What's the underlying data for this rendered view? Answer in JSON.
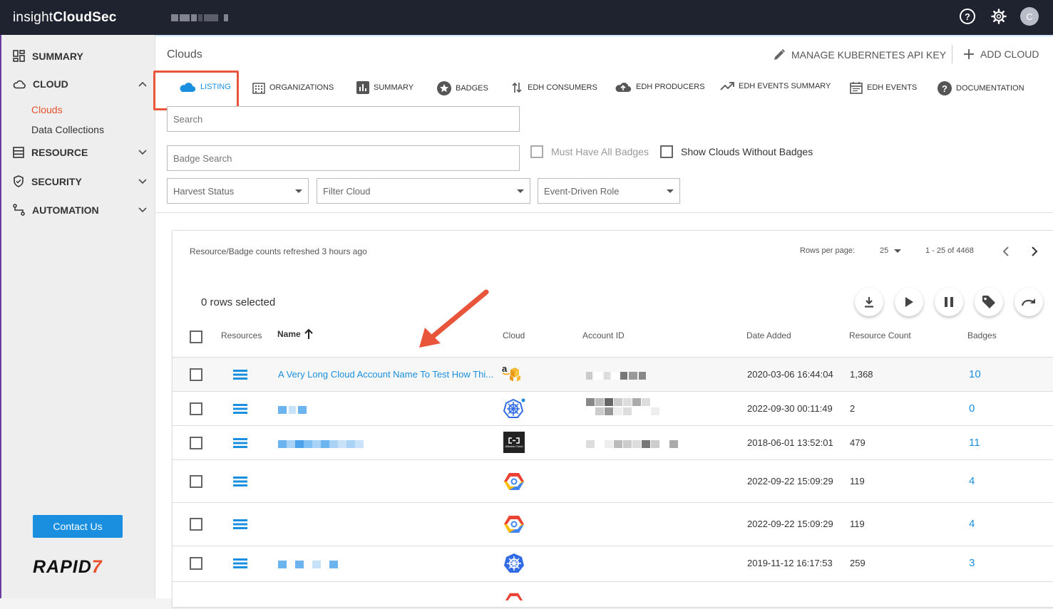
{
  "topbar": {
    "brand_light": "insight",
    "brand_bold": "CloudSec",
    "avatar_initial": "C",
    "help_icon": "help-circle-icon",
    "settings_icon": "gear-icon"
  },
  "sidebar": {
    "items": [
      {
        "label": "SUMMARY",
        "icon": "dashboard-grid-icon"
      },
      {
        "label": "CLOUD",
        "icon": "cloud-icon"
      },
      {
        "label": "RESOURCE",
        "icon": "list-icon"
      },
      {
        "label": "SECURITY",
        "icon": "shield-icon"
      },
      {
        "label": "AUTOMATION",
        "icon": "flow-icon"
      }
    ],
    "cloud_sub": [
      {
        "label": "Clouds",
        "active": true
      },
      {
        "label": "Data Collections",
        "active": false
      }
    ],
    "contact_label": "Contact Us",
    "logo_text": "RAPID",
    "logo_mark": "7"
  },
  "header": {
    "title": "Clouds",
    "manage_label": "MANAGE KUBERNETES API KEY",
    "add_label": "ADD CLOUD"
  },
  "tabs": [
    {
      "label": "LISTING",
      "icon": "cloud-icon",
      "active": true
    },
    {
      "label": "ORGANIZATIONS",
      "icon": "building-icon"
    },
    {
      "label": "SUMMARY",
      "icon": "bar-chart-icon"
    },
    {
      "label": "BADGES",
      "icon": "star-badge-icon"
    },
    {
      "label": "EDH CONSUMERS",
      "icon": "swap-vert-icon"
    },
    {
      "label": "EDH PRODUCERS",
      "icon": "cloud-upload-icon"
    },
    {
      "label": "EDH EVENTS SUMMARY",
      "icon": "trending-up-icon"
    },
    {
      "label": "EDH EVENTS",
      "icon": "calendar-icon"
    },
    {
      "label": "DOCUMENTATION",
      "icon": "help-circle-icon"
    }
  ],
  "filters": {
    "search_placeholder": "Search",
    "badge_search_placeholder": "Badge Search",
    "must_have_all_badges": "Must Have All Badges",
    "show_without_badges": "Show Clouds Without Badges",
    "harvest_status": "Harvest Status",
    "filter_cloud": "Filter Cloud",
    "event_driven_role": "Event-Driven Role"
  },
  "table": {
    "refreshed_text": "Resource/Badge counts refreshed 3 hours ago",
    "rows_per_page_label": "Rows per page:",
    "rows_per_page": "25",
    "range": "1 - 25 of 4468",
    "rows_selected": "0 rows selected",
    "columns": {
      "resources": "Resources",
      "name": "Name",
      "cloud": "Cloud",
      "account_id": "Account ID",
      "date_added": "Date Added",
      "resource_count": "Resource Count",
      "badges": "Badges"
    },
    "rows": [
      {
        "name": "A Very Long Cloud Account Name To Test How Thi...",
        "cloud": "aws",
        "date": "2020-03-06 16:44:04",
        "count": "1,368",
        "badges": "10"
      },
      {
        "name": "",
        "cloud": "kubernetes",
        "date": "2022-09-30 00:11:49",
        "count": "2",
        "badges": "0"
      },
      {
        "name": "",
        "cloud": "alibaba",
        "date": "2018-06-01 13:52:01",
        "count": "479",
        "badges": "11"
      },
      {
        "name": "",
        "cloud": "gcp",
        "date": "2022-09-22 15:09:29",
        "count": "119",
        "badges": "4"
      },
      {
        "name": "",
        "cloud": "gcp",
        "date": "2022-09-22 15:09:29",
        "count": "119",
        "badges": "4"
      },
      {
        "name": "",
        "cloud": "kubernetes",
        "date": "2019-11-12 16:17:53",
        "count": "259",
        "badges": "3"
      }
    ],
    "alibaba_logo_text": "Alibaba Cloud"
  }
}
